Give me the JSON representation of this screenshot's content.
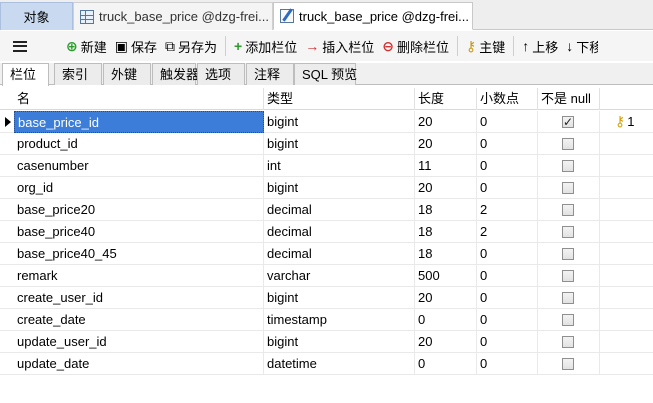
{
  "tabs": [
    {
      "label": "对象"
    },
    {
      "label": "truck_base_price @dzg-frei..."
    },
    {
      "label": "truck_base_price @dzg-frei..."
    }
  ],
  "toolbar": {
    "new_label": "新建",
    "save_label": "保存",
    "save_as_label": "另存为",
    "add_column_label": "添加栏位",
    "insert_column_label": "插入栏位",
    "delete_column_label": "删除栏位",
    "primary_key_label": "主键",
    "move_up_label": "上移",
    "move_down_label": "下移"
  },
  "subtabs": [
    "栏位",
    "索引",
    "外键",
    "触发器",
    "选项",
    "注释",
    "SQL 预览"
  ],
  "columns": {
    "name": "名",
    "type": "类型",
    "length": "长度",
    "decimals": "小数点",
    "not_null": "不是 null"
  },
  "rows": [
    {
      "name": "base_price_id",
      "type": "bigint",
      "length": "20",
      "decimals": "0",
      "not_null": true,
      "key": "1",
      "selected": true
    },
    {
      "name": "product_id",
      "type": "bigint",
      "length": "20",
      "decimals": "0",
      "not_null": false
    },
    {
      "name": "casenumber",
      "type": "int",
      "length": "11",
      "decimals": "0",
      "not_null": false
    },
    {
      "name": "org_id",
      "type": "bigint",
      "length": "20",
      "decimals": "0",
      "not_null": false
    },
    {
      "name": "base_price20",
      "type": "decimal",
      "length": "18",
      "decimals": "2",
      "not_null": false
    },
    {
      "name": "base_price40",
      "type": "decimal",
      "length": "18",
      "decimals": "2",
      "not_null": false
    },
    {
      "name": "base_price40_45",
      "type": "decimal",
      "length": "18",
      "decimals": "0",
      "not_null": false
    },
    {
      "name": "remark",
      "type": "varchar",
      "length": "500",
      "decimals": "0",
      "not_null": false
    },
    {
      "name": "create_user_id",
      "type": "bigint",
      "length": "20",
      "decimals": "0",
      "not_null": false
    },
    {
      "name": "create_date",
      "type": "timestamp",
      "length": "0",
      "decimals": "0",
      "not_null": false
    },
    {
      "name": "update_user_id",
      "type": "bigint",
      "length": "20",
      "decimals": "0",
      "not_null": false
    },
    {
      "name": "update_date",
      "type": "datetime",
      "length": "0",
      "decimals": "0",
      "not_null": false
    }
  ]
}
